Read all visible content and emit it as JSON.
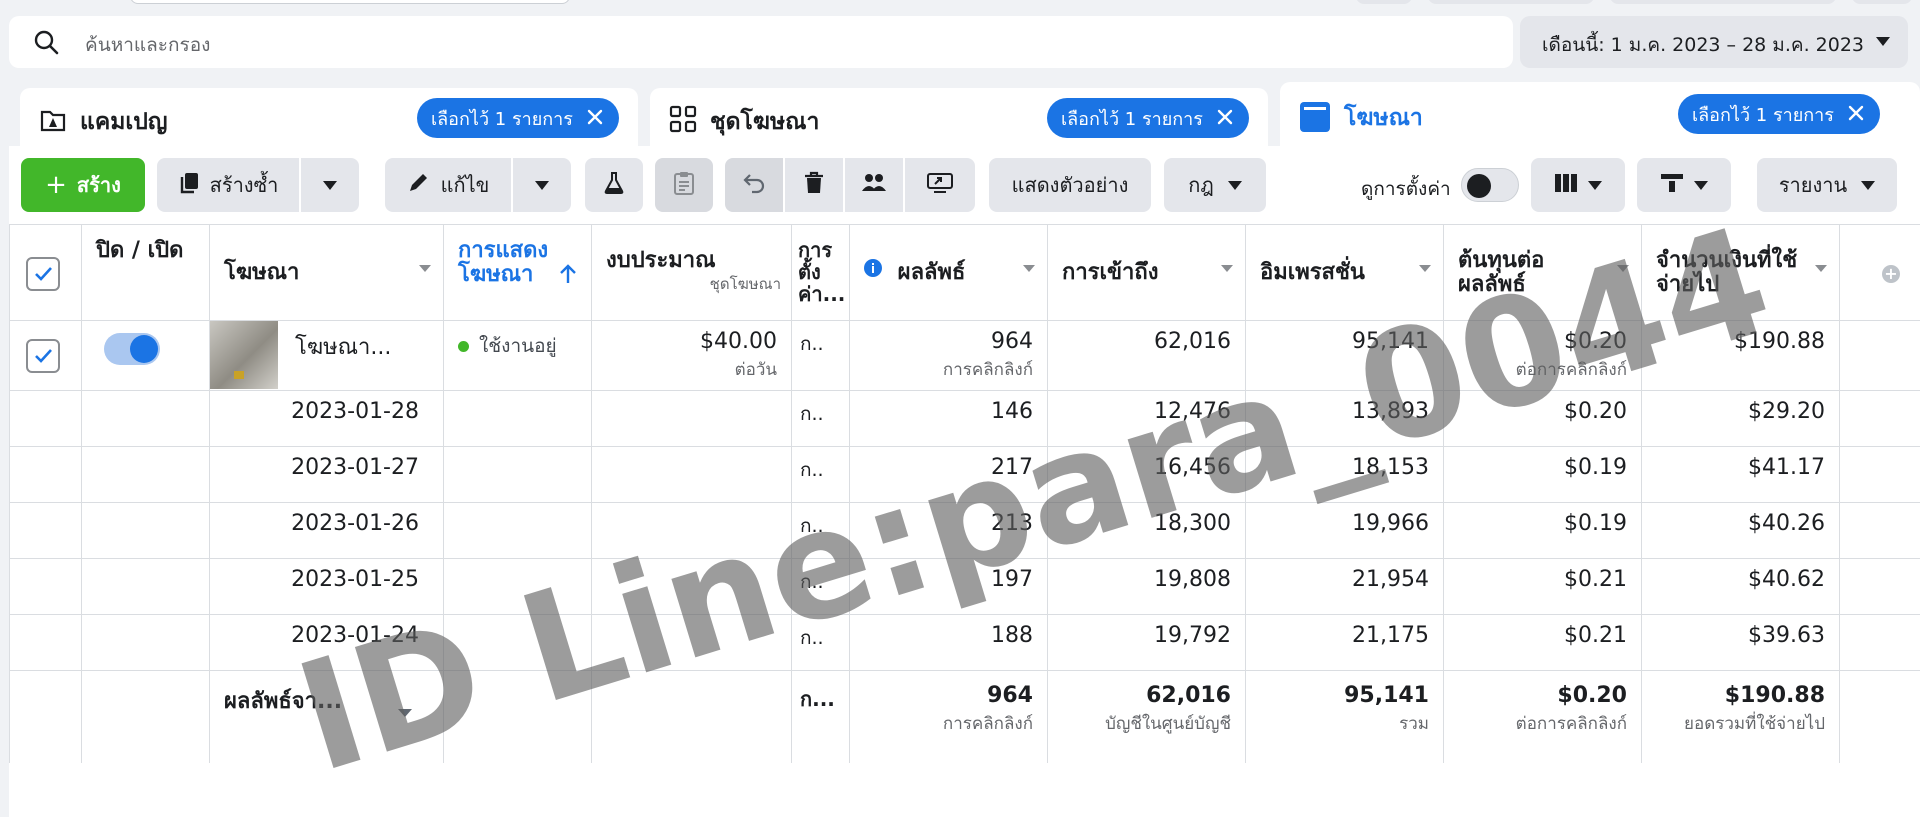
{
  "search": {
    "placeholder": "ค้นหาและกรอง"
  },
  "date_range": {
    "label": "เดือนนี้: 1 ม.ค. 2023 – 28 ม.ค. 2023"
  },
  "tabs": [
    {
      "label": "แคมเปญ",
      "selected_pill": "เลือกไว้ 1 รายการ"
    },
    {
      "label": "ชุดโฆษณา",
      "selected_pill": "เลือกไว้ 1 รายการ"
    },
    {
      "label": "โฆษณา",
      "selected_pill": "เลือกไว้ 1 รายการ"
    }
  ],
  "toolbar": {
    "create": "สร้าง",
    "duplicate": "สร้างซ้ำ",
    "edit": "แก้ไข",
    "preview": "แสดงตัวอย่าง",
    "rules": "กฎ",
    "view_setup": "ดูการตั้งค่า",
    "reports": "รายงาน"
  },
  "columns": {
    "onoff": "ปิด / เปิด",
    "ad": "โฆษณา",
    "delivery": "การแสดงโฆษณา",
    "budget": "งบประมาณ",
    "budget_sub": "ชุดโฆษณา",
    "attribution": "การตั้งค่า...",
    "results": "ผลลัพธ์",
    "reach": "การเข้าถึง",
    "impressions": "อิมเพรสชั่น",
    "cost_per_result": "ต้นทุนต่อผลลัพธ์",
    "amount_spent": "จำนวนเงินที่ใช้จ่ายไป"
  },
  "ad_row": {
    "name": "โฆษณา...",
    "delivery": "ใช้งานอยู่",
    "budget": "$40.00",
    "budget_sub": "ต่อวัน",
    "attribution": "ก..",
    "results": "964",
    "results_sub": "การคลิกลิงก์",
    "reach": "62,016",
    "impressions": "95,141",
    "cost": "$0.20",
    "cost_sub": "ต่อการคลิกลิงก์",
    "spent": "$190.88"
  },
  "daily_rows": [
    {
      "date": "2023-01-28",
      "attribution": "ก..",
      "results": "146",
      "reach": "12,476",
      "impressions": "13,893",
      "cost": "$0.20",
      "spent": "$29.20"
    },
    {
      "date": "2023-01-27",
      "attribution": "ก..",
      "results": "217",
      "reach": "16,456",
      "impressions": "18,153",
      "cost": "$0.19",
      "spent": "$41.17"
    },
    {
      "date": "2023-01-26",
      "attribution": "ก..",
      "results": "213",
      "reach": "18,300",
      "impressions": "19,966",
      "cost": "$0.19",
      "spent": "$40.26"
    },
    {
      "date": "2023-01-25",
      "attribution": "ก..",
      "results": "197",
      "reach": "19,808",
      "impressions": "21,954",
      "cost": "$0.21",
      "spent": "$40.62"
    },
    {
      "date": "2023-01-24",
      "attribution": "ก..",
      "results": "188",
      "reach": "19,792",
      "impressions": "21,175",
      "cost": "$0.21",
      "spent": "$39.63"
    }
  ],
  "total_row": {
    "label": "ผลลัพธ์จา...",
    "attribution": "ก...",
    "results": "964",
    "results_sub": "การคลิกลิงก์",
    "reach": "62,016",
    "reach_sub": "บัญชีในศูนย์บัญชี",
    "impressions": "95,141",
    "impressions_sub": "รวม",
    "cost": "$0.20",
    "cost_sub": "ต่อการคลิกลิงก์",
    "spent": "$190.88",
    "spent_sub": "ยอดรวมที่ใช้จ่ายไป"
  },
  "watermark": "ID Line:para_0044"
}
